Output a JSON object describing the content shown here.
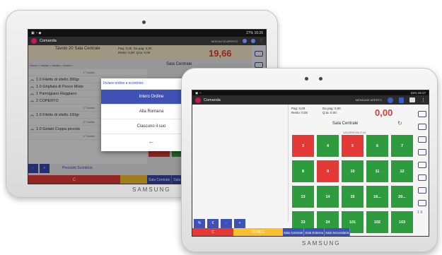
{
  "back": {
    "brand": "SAMSUNG",
    "status_time": "16:26",
    "status_battery": "27%",
    "app_title": "Comanda",
    "mode": "MODALITÀ APERTO",
    "table_title": "Tavolo 20 Sala Centrale",
    "pagato": "Pag: 0,00",
    "da_pagare": "Da pag: 0,00",
    "resto": "Resto: 0,00",
    "quantita": "Q.ta: 0,00",
    "total": "19,66",
    "sala": "Sala Centrale",
    "breadcrumbs": "Home > Uscita > Uscita > Uscita > ",
    "order_rows": [
      {
        "kind": "sub",
        "text": "1° Uscita"
      },
      {
        "kind": "item",
        "text": "1.0 Filetto di vitello 300gr"
      },
      {
        "kind": "item",
        "text": "1.0 Grigliata di Pesce Misto"
      },
      {
        "kind": "item",
        "text": "1 Parmigiano Reggiano"
      },
      {
        "kind": "item",
        "text": "2 COPERTO"
      },
      {
        "kind": "sub",
        "text": "2° Uscita"
      },
      {
        "kind": "item",
        "text": "1.0 Filetto di vitello 100gr"
      },
      {
        "kind": "sub",
        "text": "3° Uscita"
      },
      {
        "kind": "item",
        "text": "1.0 Gelato Coppa piccola"
      },
      {
        "kind": "sub",
        "text": "4° Uscita"
      },
      {
        "kind": "item",
        "text": "Preconto Scontrino"
      }
    ],
    "dialog": {
      "title": "Inviare ordine a scontrino:",
      "options": [
        "Intero Ordine",
        "Alla Romana",
        "Ciascuno il suo"
      ],
      "selected": "Intero Ordine",
      "back_glyph": "←"
    },
    "bottom": {
      "clear": "C",
      "sala_centrale": "Sala Centrale",
      "sala_esterna": "Sala Esterna",
      "sala_sec": "Sa"
    }
  },
  "front": {
    "brand": "SAMSUNG",
    "status_time": "15:17",
    "status_battery": "41%",
    "app_title": "Comanda",
    "mode": "MENSAGE APERTO",
    "pagato": "Pag: 0,00",
    "da_pagare": "Da pag: 0,00",
    "resto": "Resto: 0,00",
    "quantita": "Q.ta: 0,00",
    "total": "0,00",
    "sala": "Sala Centrale",
    "refresh_glyph": "↻",
    "date": "12/12/2019 15:17:43",
    "tables": [
      {
        "n": "3",
        "status": "red"
      },
      {
        "n": "4",
        "status": "green"
      },
      {
        "n": "5",
        "status": "red"
      },
      {
        "n": "6",
        "status": "green"
      },
      {
        "n": "7",
        "status": "green"
      },
      {
        "n": "8",
        "status": "green"
      },
      {
        "n": "9",
        "status": "red"
      },
      {
        "n": "10",
        "status": "green"
      },
      {
        "n": "11",
        "status": "green"
      },
      {
        "n": "12",
        "status": "green"
      },
      {
        "n": "13",
        "status": "green"
      },
      {
        "n": "14",
        "status": "green"
      },
      {
        "n": "15",
        "status": "green"
      },
      {
        "n": "16...",
        "status": "green"
      },
      {
        "n": "20...",
        "status": "green"
      },
      {
        "n": "23",
        "status": "green"
      },
      {
        "n": "24",
        "status": "green"
      },
      {
        "n": "101",
        "status": "green"
      },
      {
        "n": "102",
        "status": "green"
      },
      {
        "n": "103",
        "status": "green"
      }
    ],
    "keypad": [
      "%",
      "€",
      "-",
      "+"
    ],
    "clear": "C",
    "totale": "TOTALE",
    "sale": [
      "Sala Centrale",
      "Sala Esterna",
      "Sala Secondaria"
    ],
    "qty": "1 X",
    "colors": {
      "green": "#2e9c3e",
      "red": "#e53935",
      "blue": "#3f51b5",
      "yellow": "#fbc02d"
    }
  }
}
